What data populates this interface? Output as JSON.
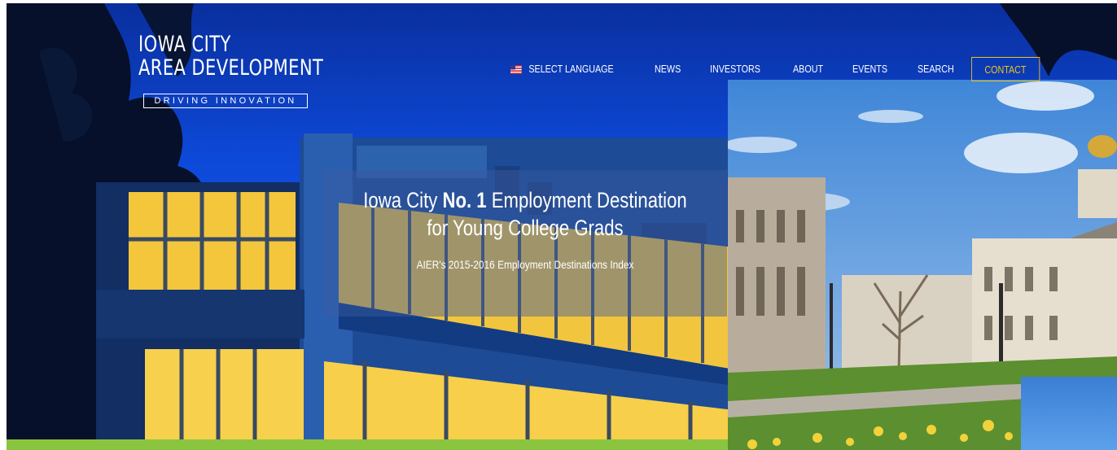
{
  "logo": {
    "line1": "IOWA CITY",
    "line2": "AREA DEVELOPMENT",
    "tagline": "DRIVING INNOVATION"
  },
  "nav": {
    "items": [
      {
        "label": "SELECT LANGUAGE",
        "icon": "us-flag-icon"
      },
      {
        "label": "NEWS"
      },
      {
        "label": "INVESTORS"
      },
      {
        "label": "ABOUT"
      },
      {
        "label": "EVENTS"
      },
      {
        "label": "SEARCH"
      },
      {
        "label": "CONTACT"
      }
    ]
  },
  "hero": {
    "headline_pre": "Iowa City ",
    "headline_strong": "No. 1",
    "headline_post": " Employment Destination",
    "headline_line2": "for Young College Grads",
    "subline": "AIER's 2015-2016 Employment Destinations Index"
  },
  "colors": {
    "accent": "#f0c419",
    "green_strip": "#8bc53f",
    "sky_blue": "#1452e6"
  }
}
